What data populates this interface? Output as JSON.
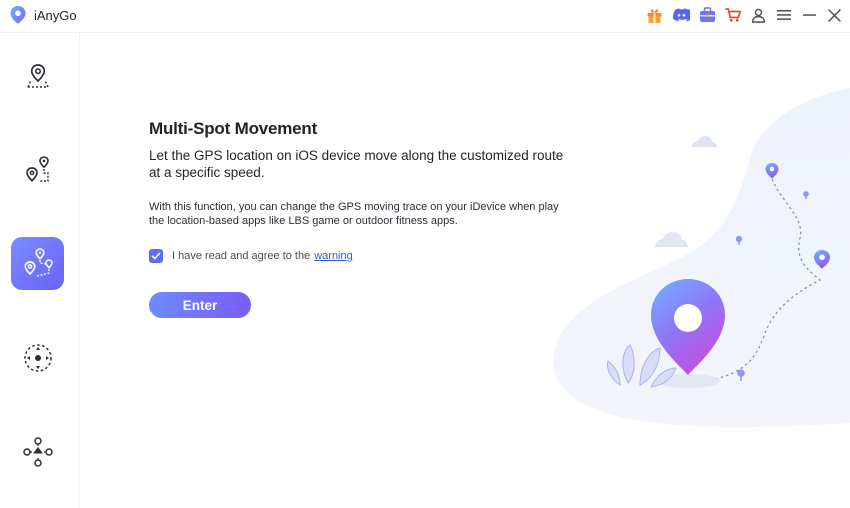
{
  "app": {
    "name": "iAnyGo"
  },
  "titlebar": {
    "icons": [
      "gift-icon",
      "discord-icon",
      "toolbox-icon",
      "cart-icon",
      "user-icon",
      "menu-icon",
      "minimize-icon",
      "close-icon"
    ]
  },
  "sidebar": {
    "items": [
      {
        "name": "change-location",
        "icon": "map-pin-icon",
        "active": false
      },
      {
        "name": "single-spot-movement",
        "icon": "two-spot-route-icon",
        "active": false
      },
      {
        "name": "multi-spot-movement",
        "icon": "multi-spot-route-icon",
        "active": true
      },
      {
        "name": "joystick-movement",
        "icon": "joystick-icon",
        "active": false
      },
      {
        "name": "more-modes",
        "icon": "joystick-pad-icon",
        "active": false
      }
    ]
  },
  "main": {
    "title": "Multi-Spot Movement",
    "subtitle": "Let the GPS location on iOS device move along the customized route at a specific speed.",
    "description": "With this function, you can change the GPS moving trace on your iDevice when play the location-based apps like LBS game or outdoor fitness apps.",
    "agree_text": "I have read and agree to the",
    "agree_link": "warning",
    "agree_checked": true,
    "enter_label": "Enter"
  },
  "colors": {
    "accent": "#6a62f5",
    "accent_light": "#7a8cff",
    "link": "#2f5bd6",
    "gift": "#f28b2e",
    "cart": "#e04a3c"
  }
}
